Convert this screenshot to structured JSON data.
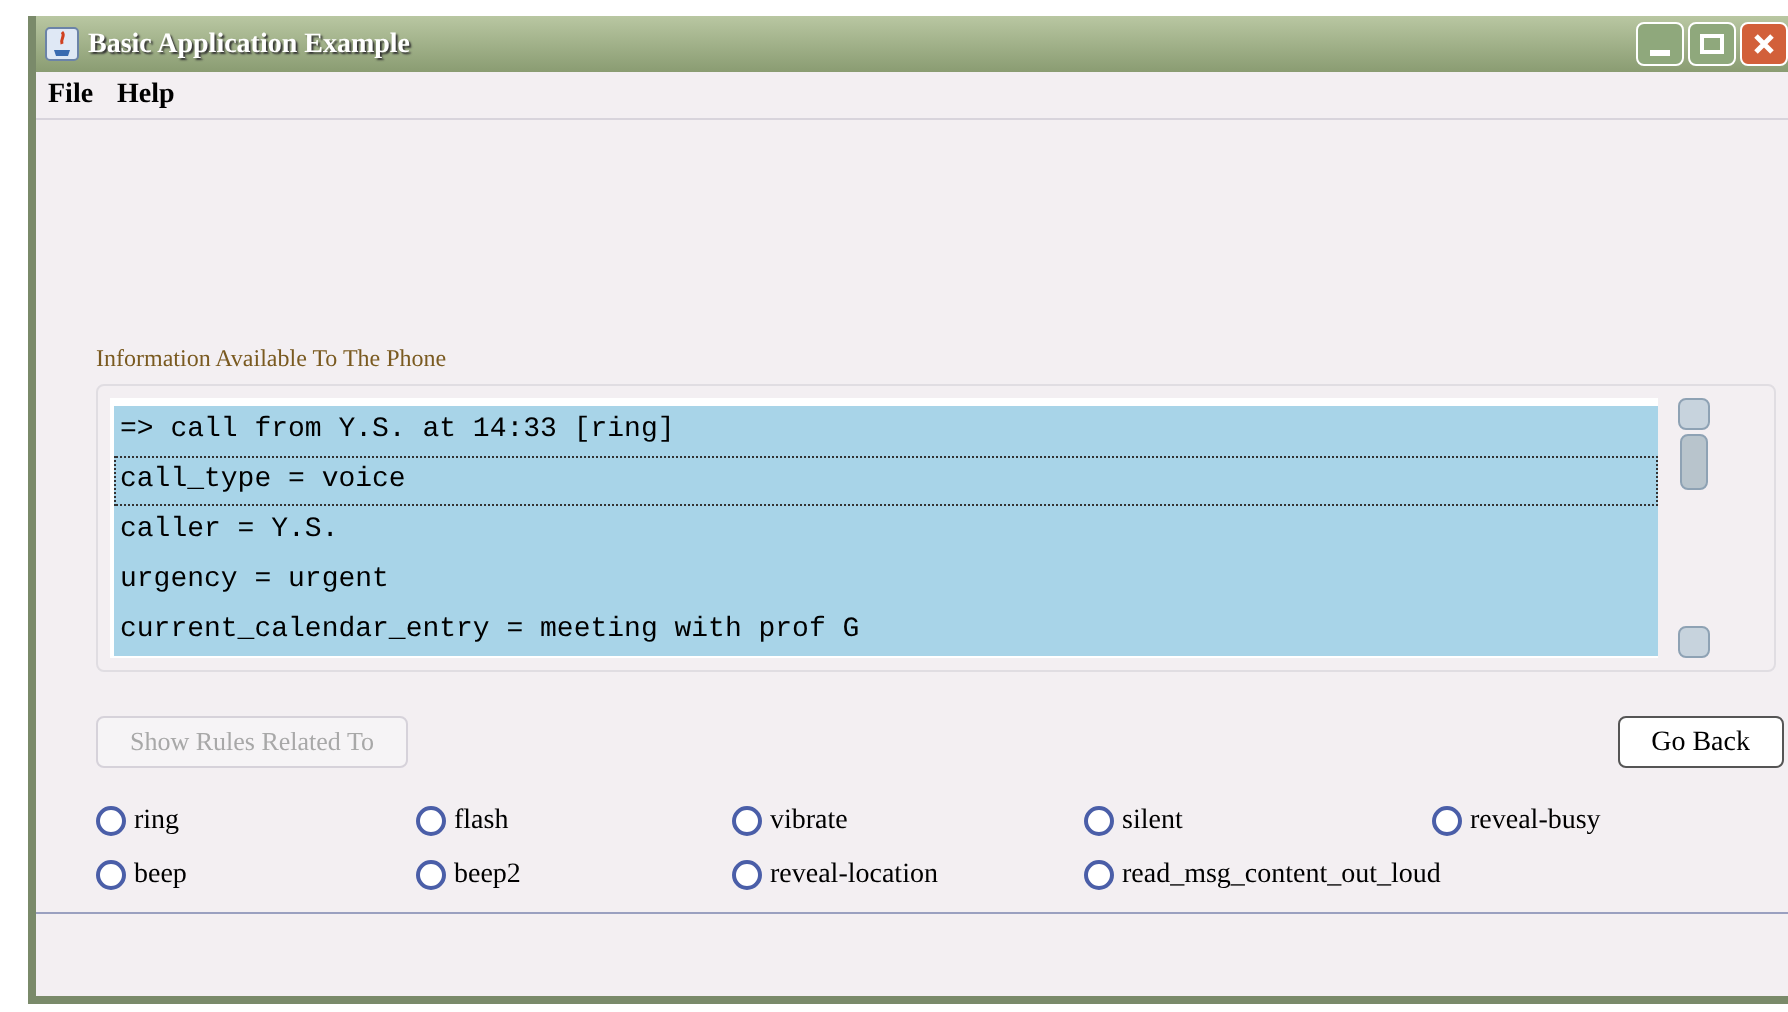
{
  "window": {
    "title": "Basic Application Example"
  },
  "menu": [
    "File",
    "Help"
  ],
  "info_panel": {
    "title": "Information Available To The Phone",
    "lines": [
      {
        "text": "=> call from Y.S. at 14:33 [ring]",
        "selected": true,
        "focused": false
      },
      {
        "text": "call_type = voice",
        "selected": true,
        "focused": true
      },
      {
        "text": "caller = Y.S.",
        "selected": true,
        "focused": false
      },
      {
        "text": "urgency = urgent",
        "selected": true,
        "focused": false
      },
      {
        "text": "current_calendar_entry = meeting with prof G",
        "selected": true,
        "focused": false
      }
    ]
  },
  "show_rules_button": {
    "label": "Show Rules Related To",
    "disabled": true
  },
  "go_back_button": {
    "label": "Go Back"
  },
  "options": [
    [
      {
        "label": "ring",
        "selected": false
      },
      {
        "label": "flash",
        "selected": false
      },
      {
        "label": "vibrate",
        "selected": false
      },
      {
        "label": "silent",
        "selected": false
      },
      {
        "label": "reveal-busy",
        "selected": false
      }
    ],
    [
      {
        "label": "beep",
        "selected": false
      },
      {
        "label": "beep2",
        "selected": false
      },
      {
        "label": "reveal-location",
        "selected": false
      },
      {
        "label": "read_msg_content_out_loud",
        "selected": false
      }
    ]
  ]
}
